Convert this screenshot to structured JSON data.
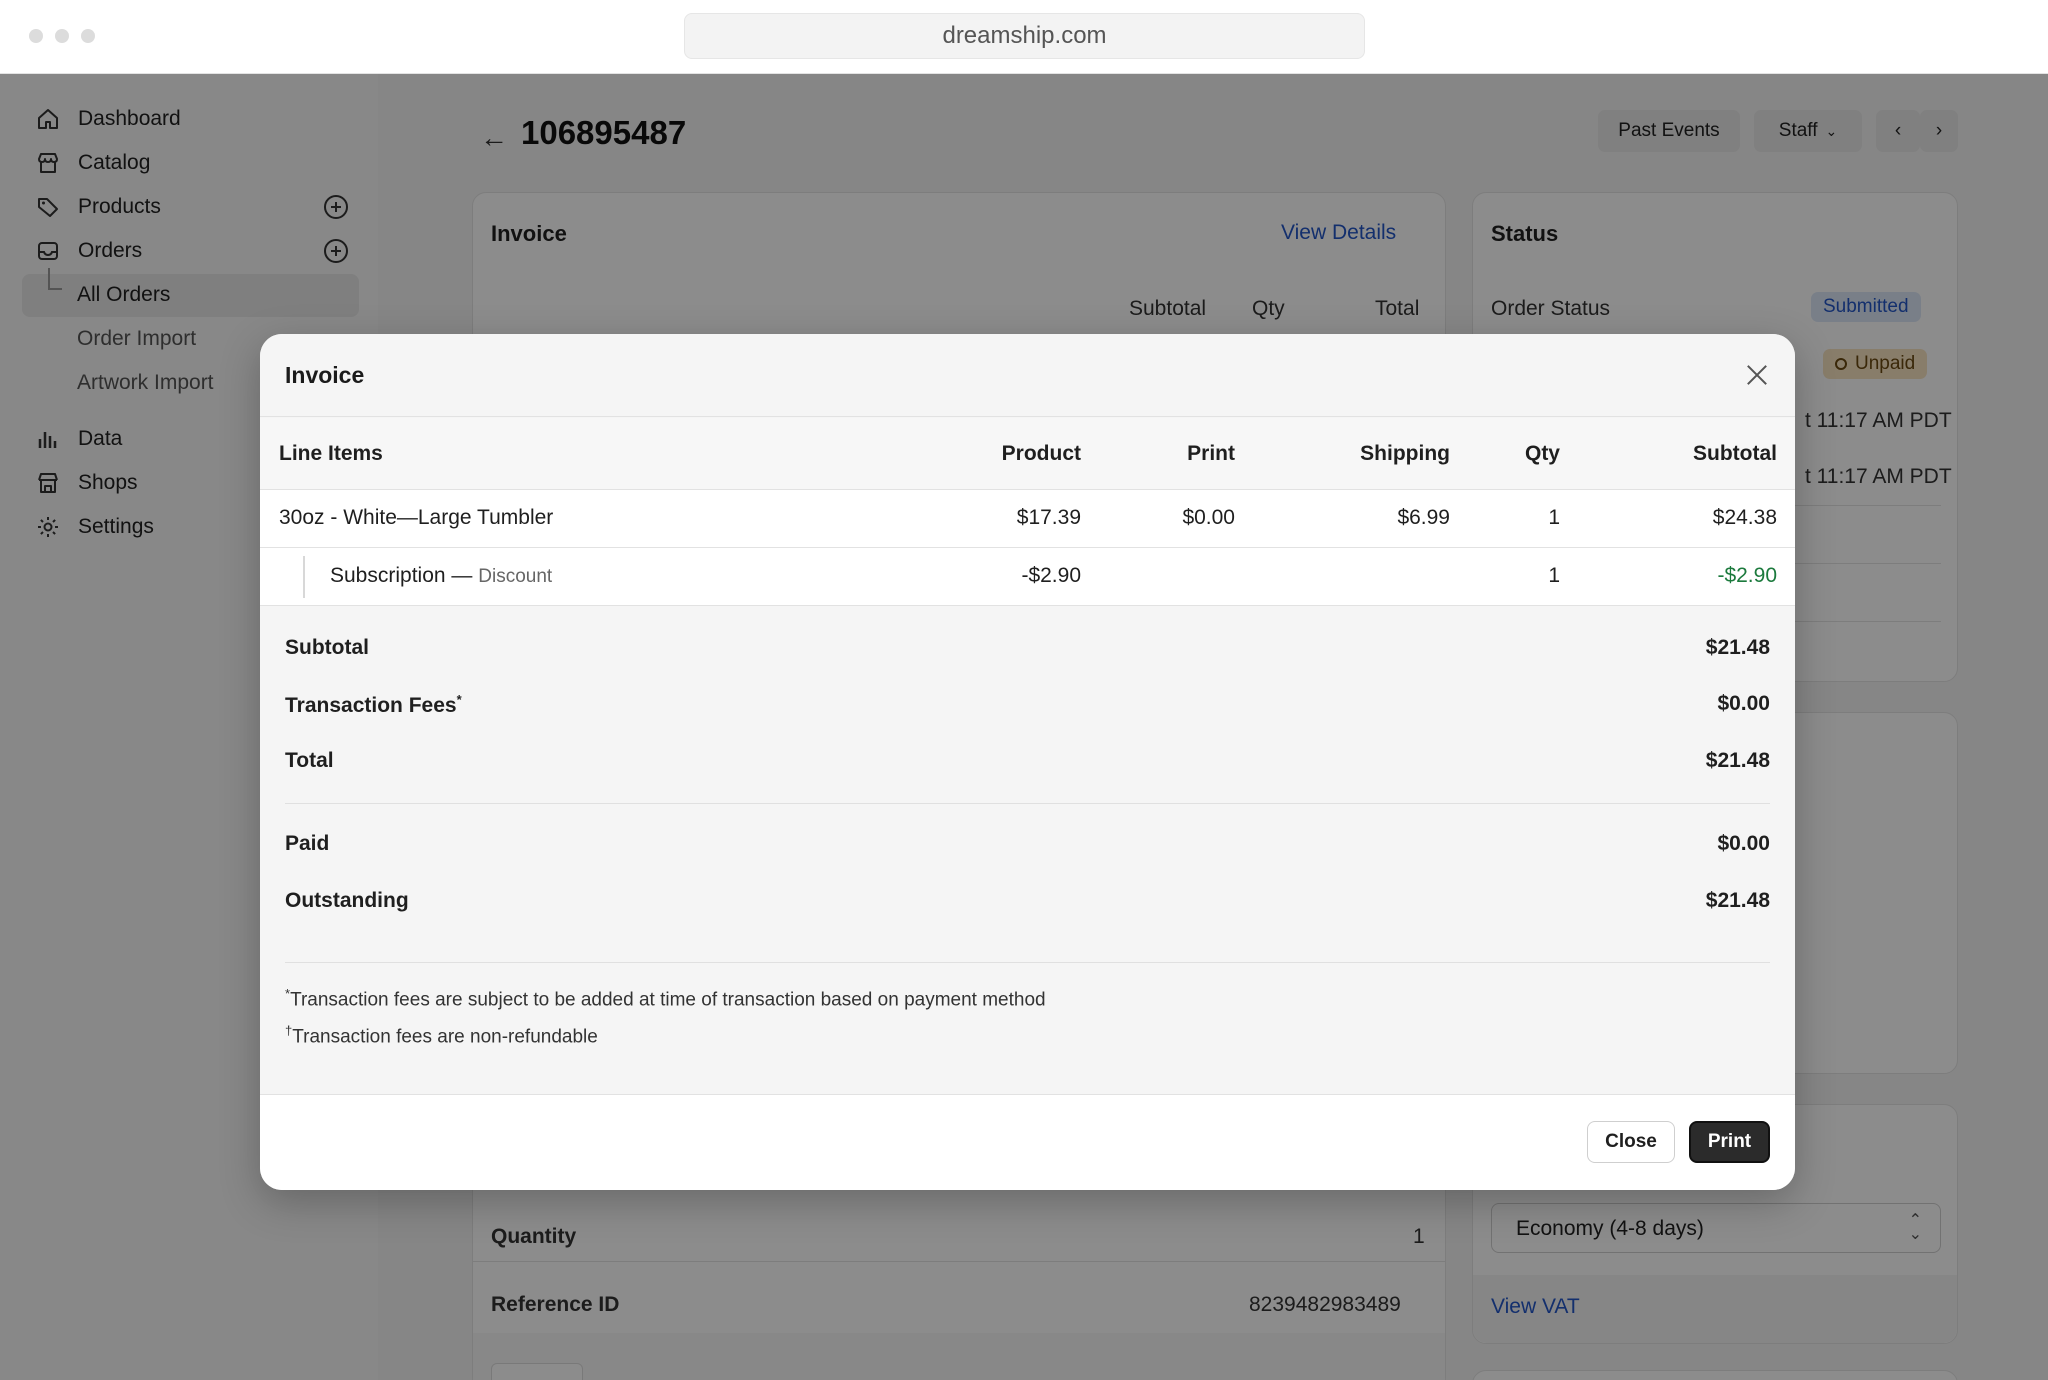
{
  "browser": {
    "url": "dreamship.com"
  },
  "sidebar": {
    "items": [
      {
        "label": "Dashboard",
        "icon": "home-icon"
      },
      {
        "label": "Catalog",
        "icon": "store-icon"
      },
      {
        "label": "Products",
        "icon": "tag-icon"
      },
      {
        "label": "Orders",
        "icon": "inbox-icon"
      },
      {
        "label": "Data",
        "icon": "bar-chart-icon"
      },
      {
        "label": "Shops",
        "icon": "shop-icon"
      },
      {
        "label": "Settings",
        "icon": "gear-icon"
      }
    ],
    "subitems": [
      "All Orders",
      "Order Import",
      "Artwork Import"
    ]
  },
  "header": {
    "order_id": "106895487",
    "past_events": "Past Events",
    "staff": "Staff"
  },
  "background": {
    "invoice_card": {
      "title": "Invoice",
      "view_details": "View Details",
      "col_subtotal": "Subtotal",
      "col_qty": "Qty",
      "col_total": "Total",
      "quantity_label": "Quantity",
      "quantity_value": "1",
      "reference_label": "Reference ID",
      "reference_value": "8239482983489"
    },
    "status_card": {
      "title": "Status",
      "order_status_label": "Order Status",
      "order_status_badge": "Submitted",
      "payment_badge": "Unpaid",
      "time1": "t 11:17 AM PDT",
      "time2": "t 11:17 AM PDT"
    },
    "shipping_card": {
      "shipping_select": "Economy (4-8 days)",
      "view_vat": "View VAT"
    }
  },
  "modal": {
    "title": "Invoice",
    "columns": {
      "line_items": "Line Items",
      "product": "Product",
      "print": "Print",
      "shipping": "Shipping",
      "qty": "Qty",
      "subtotal": "Subtotal"
    },
    "rows": [
      {
        "name": "30oz - White—Large Tumbler",
        "product": "$17.39",
        "print": "$0.00",
        "shipping": "$6.99",
        "qty": "1",
        "subtotal": "$24.38"
      }
    ],
    "discount_row": {
      "name": "Subscription —",
      "tag": "Discount",
      "product": "-$2.90",
      "qty": "1",
      "subtotal": "-$2.90"
    },
    "summary": {
      "subtotal_label": "Subtotal",
      "subtotal_value": "$21.48",
      "fees_label": "Transaction Fees",
      "fees_mark": "*",
      "fees_value": "$0.00",
      "total_label": "Total",
      "total_value": "$21.48",
      "paid_label": "Paid",
      "paid_value": "$0.00",
      "outstanding_label": "Outstanding",
      "outstanding_value": "$21.48"
    },
    "notes": {
      "note1_mark": "*",
      "note1": "Transaction fees are subject to be added at time of transaction based on payment method",
      "note2_mark": "†",
      "note2": "Transaction fees are non-refundable"
    },
    "buttons": {
      "close": "Close",
      "print": "Print"
    }
  }
}
